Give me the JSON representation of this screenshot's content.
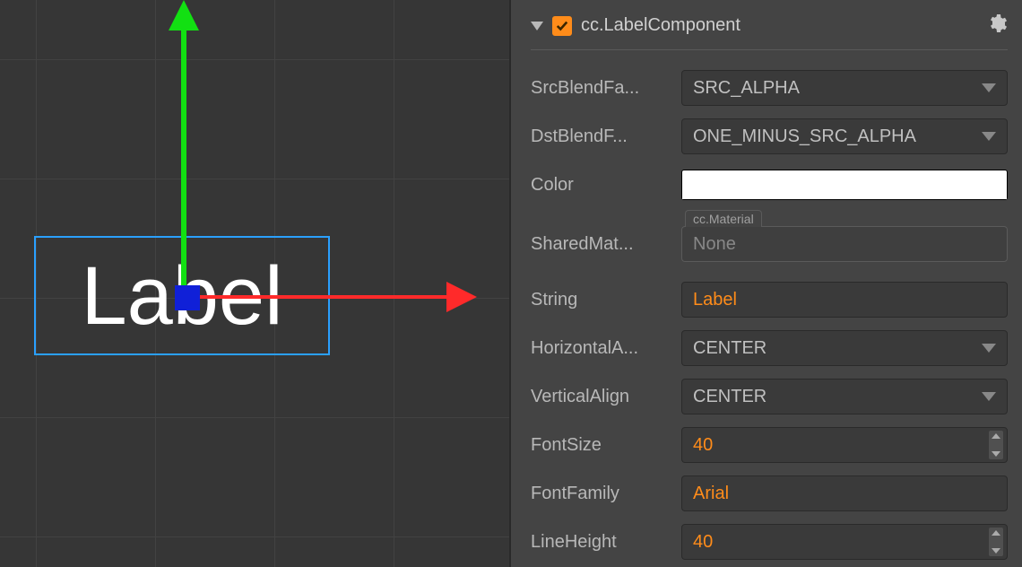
{
  "viewport": {
    "label_text": "Label"
  },
  "component": {
    "title": "cc.LabelComponent",
    "enabled": true
  },
  "props": {
    "srcBlendFactor": {
      "label": "SrcBlendFa...",
      "value": "SRC_ALPHA"
    },
    "dstBlendFactor": {
      "label": "DstBlendF...",
      "value": "ONE_MINUS_SRC_ALPHA"
    },
    "color": {
      "label": "Color",
      "hex": "#FFFFFF"
    },
    "sharedMaterial": {
      "label": "SharedMat...",
      "type": "cc.Material",
      "value": "None"
    },
    "string": {
      "label": "String",
      "value": "Label"
    },
    "horizontalAlign": {
      "label": "HorizontalA...",
      "value": "CENTER"
    },
    "verticalAlign": {
      "label": "VerticalAlign",
      "value": "CENTER"
    },
    "fontSize": {
      "label": "FontSize",
      "value": "40"
    },
    "fontFamily": {
      "label": "FontFamily",
      "value": "Arial"
    },
    "lineHeight": {
      "label": "LineHeight",
      "value": "40"
    }
  }
}
